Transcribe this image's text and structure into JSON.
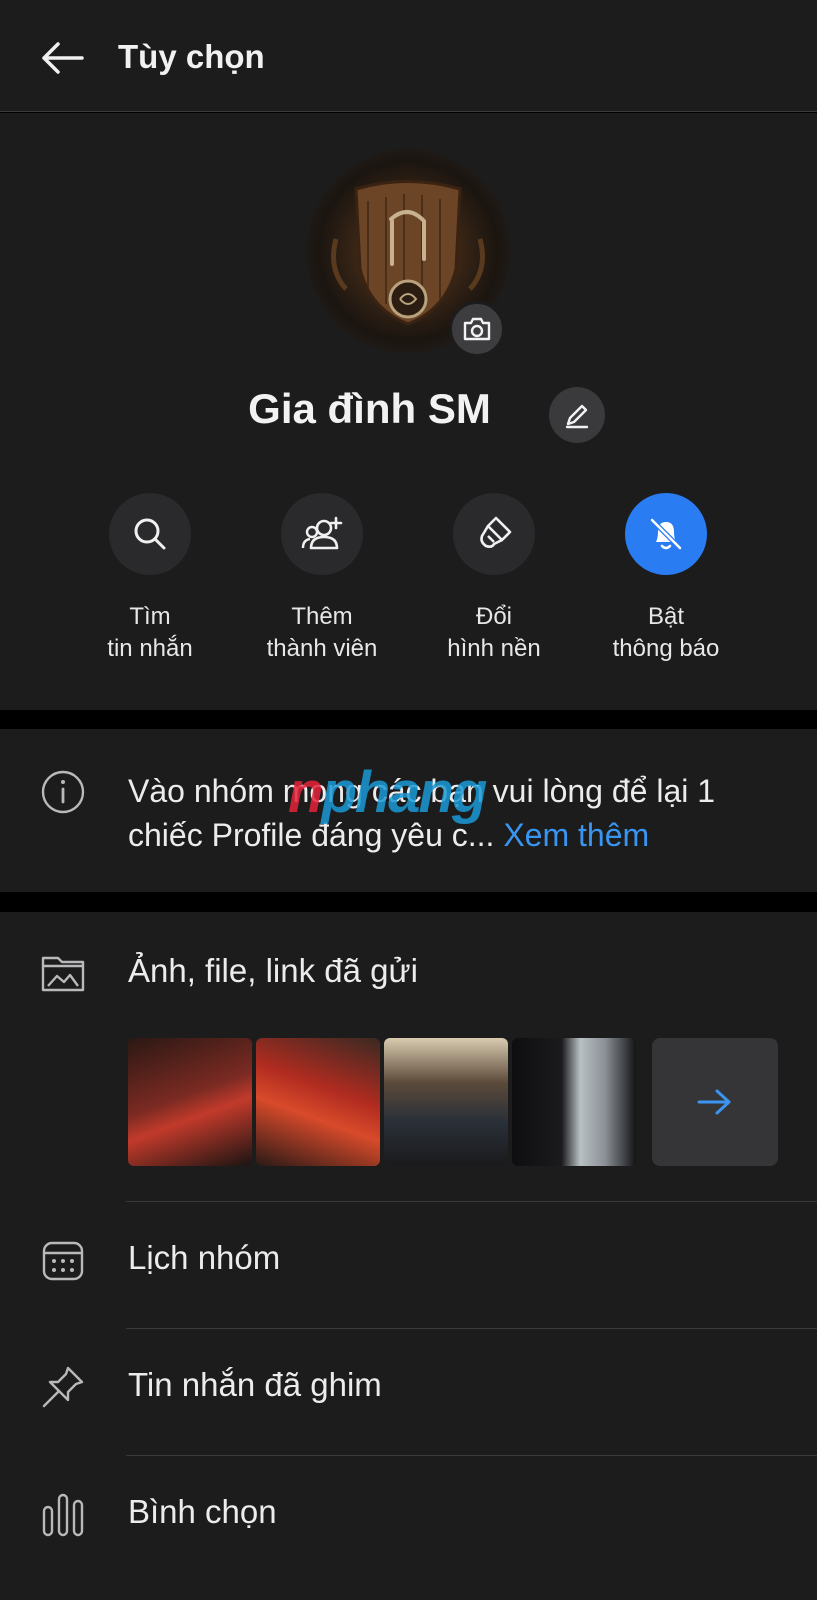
{
  "header": {
    "title": "Tùy chọn"
  },
  "group": {
    "name": "Gia đình SM"
  },
  "actions": [
    {
      "label_line1": "Tìm",
      "label_line2": "tin nhắn",
      "icon": "search-icon"
    },
    {
      "label_line1": "Thêm",
      "label_line2": "thành viên",
      "icon": "add-member-icon"
    },
    {
      "label_line1": "Đổi",
      "label_line2": "hình nền",
      "icon": "paint-brush-icon"
    },
    {
      "label_line1": "Bật",
      "label_line2": "thông báo",
      "icon": "bell-off-icon"
    }
  ],
  "description": {
    "text": "Vào nhóm mong các bạn vui lòng để lại 1 chiếc Profile đáng yêu c...",
    "see_more": "Xem thêm"
  },
  "watermark": {
    "part1": "n",
    "part2": "phang"
  },
  "media": {
    "label": "Ảnh, file, link đã gửi"
  },
  "menu": [
    {
      "label": "Lịch nhóm",
      "icon": "calendar-icon"
    },
    {
      "label": "Tin nhắn đã ghim",
      "icon": "pin-icon"
    },
    {
      "label": "Bình chọn",
      "icon": "poll-icon"
    }
  ],
  "colors": {
    "accent": "#2a7cf3",
    "link": "#3a95f0",
    "background": "#1c1c1d"
  }
}
